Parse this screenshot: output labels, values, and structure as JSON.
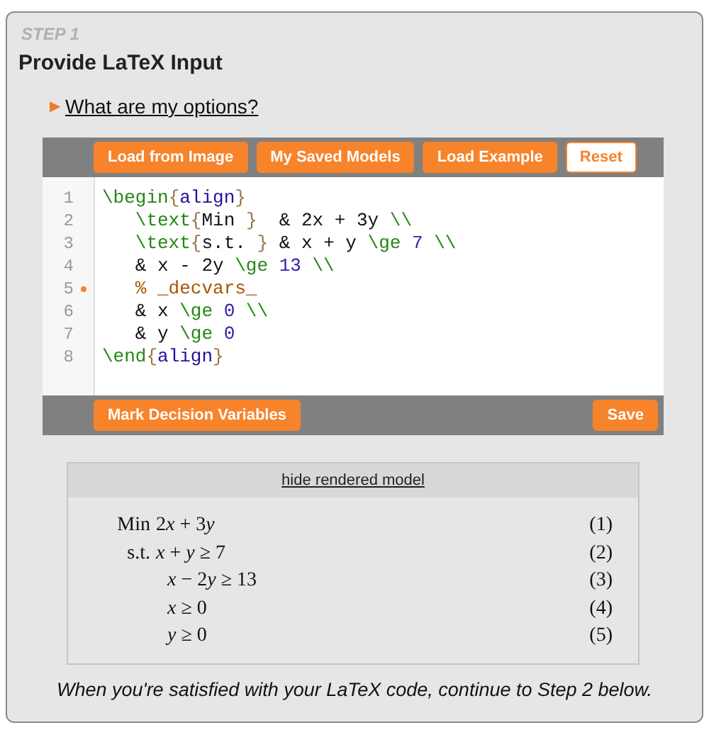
{
  "step_label": "STEP 1",
  "title": "Provide LaTeX Input",
  "options_link": {
    "marker": "▶",
    "label": "What are my options?"
  },
  "editor": {
    "top_buttons": [
      {
        "label": "Load from Image",
        "kind": "filled"
      },
      {
        "label": "My Saved Models",
        "kind": "filled"
      },
      {
        "label": "Load Example",
        "kind": "filled"
      },
      {
        "label": "Reset",
        "kind": "outline"
      }
    ],
    "lines": [
      {
        "number": "1",
        "marked": false,
        "tokens": [
          {
            "kind": "command",
            "text": "\\begin"
          },
          {
            "kind": "brace",
            "text": "{"
          },
          {
            "kind": "arg",
            "text": "align"
          },
          {
            "kind": "brace",
            "text": "}"
          }
        ]
      },
      {
        "number": "2",
        "marked": false,
        "tokens": [
          {
            "kind": "command",
            "text": "   \\text"
          },
          {
            "kind": "brace",
            "text": "{"
          },
          {
            "kind": "plain",
            "text": "Min "
          },
          {
            "kind": "brace",
            "text": "}"
          },
          {
            "kind": "plain",
            "text": "  & 2x + 3y "
          },
          {
            "kind": "command",
            "text": "\\\\"
          }
        ]
      },
      {
        "number": "3",
        "marked": false,
        "tokens": [
          {
            "kind": "command",
            "text": "   \\text"
          },
          {
            "kind": "brace",
            "text": "{"
          },
          {
            "kind": "plain",
            "text": "s.t. "
          },
          {
            "kind": "brace",
            "text": "}"
          },
          {
            "kind": "plain",
            "text": " & x + y "
          },
          {
            "kind": "command",
            "text": "\\ge"
          },
          {
            "kind": "number",
            "text": " 7"
          },
          {
            "kind": "command",
            "text": " \\\\"
          }
        ]
      },
      {
        "number": "4",
        "marked": false,
        "tokens": [
          {
            "kind": "plain",
            "text": "   & x - 2y "
          },
          {
            "kind": "command",
            "text": "\\ge"
          },
          {
            "kind": "number",
            "text": " 13"
          },
          {
            "kind": "command",
            "text": " \\\\"
          }
        ]
      },
      {
        "number": "5",
        "marked": true,
        "tokens": [
          {
            "kind": "comment",
            "text": "   % _decvars_"
          }
        ]
      },
      {
        "number": "6",
        "marked": false,
        "tokens": [
          {
            "kind": "plain",
            "text": "   & x "
          },
          {
            "kind": "command",
            "text": "\\ge"
          },
          {
            "kind": "number",
            "text": " 0"
          },
          {
            "kind": "command",
            "text": " \\\\"
          }
        ]
      },
      {
        "number": "7",
        "marked": false,
        "tokens": [
          {
            "kind": "plain",
            "text": "   & y "
          },
          {
            "kind": "command",
            "text": "\\ge"
          },
          {
            "kind": "number",
            "text": " 0"
          }
        ]
      },
      {
        "number": "8",
        "marked": false,
        "tokens": [
          {
            "kind": "command",
            "text": "\\end"
          },
          {
            "kind": "brace",
            "text": "{"
          },
          {
            "kind": "arg",
            "text": "align"
          },
          {
            "kind": "brace",
            "text": "}"
          }
        ]
      }
    ],
    "bottom_buttons": [
      {
        "label": "Mark Decision Variables"
      },
      {
        "label": "Save"
      }
    ]
  },
  "rendered_model": {
    "toggle": "hide rendered model",
    "rows": [
      {
        "label": "Min",
        "expression": [
          {
            "kind": "upright",
            "text": "2"
          },
          {
            "kind": "variable",
            "text": "x"
          },
          {
            "kind": "upright",
            "text": " + 3"
          },
          {
            "kind": "variable",
            "text": "y"
          }
        ],
        "number": "(1)"
      },
      {
        "label": "s.t.",
        "expression": [
          {
            "kind": "variable",
            "text": "x"
          },
          {
            "kind": "upright",
            "text": " + "
          },
          {
            "kind": "variable",
            "text": "y"
          },
          {
            "kind": "upright",
            "text": " ≥ 7"
          }
        ],
        "number": "(2)"
      },
      {
        "expression": [
          {
            "kind": "variable",
            "text": "x"
          },
          {
            "kind": "upright",
            "text": " − 2"
          },
          {
            "kind": "variable",
            "text": "y"
          },
          {
            "kind": "upright",
            "text": " ≥ 13"
          }
        ],
        "number": "(3)"
      },
      {
        "expression": [
          {
            "kind": "variable",
            "text": "x"
          },
          {
            "kind": "upright",
            "text": " ≥ 0"
          }
        ],
        "number": "(4)"
      },
      {
        "expression": [
          {
            "kind": "variable",
            "text": "y"
          },
          {
            "kind": "upright",
            "text": " ≥ 0"
          }
        ],
        "number": "(5)"
      }
    ]
  },
  "footer": "When you're satisfied with your LaTeX code, continue to Step 2 below."
}
